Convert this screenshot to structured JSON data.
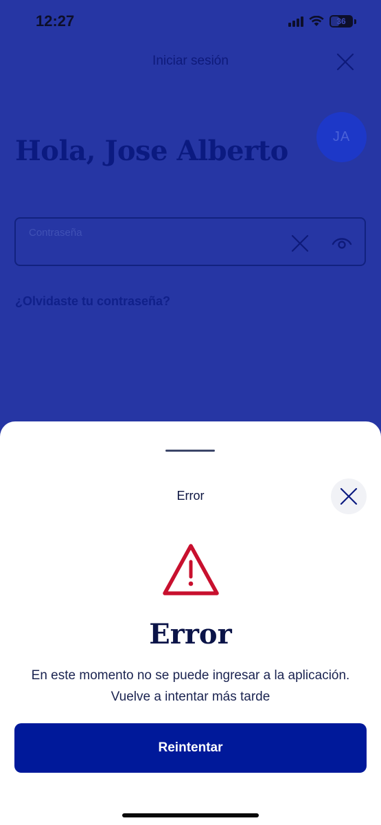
{
  "status_bar": {
    "time": "12:27",
    "battery": "36"
  },
  "login": {
    "header_title": "Iniciar sesión",
    "avatar_initials": "JA",
    "greeting": "Hola, Jose Alberto",
    "password_placeholder": "Contraseña",
    "forgot_password": "¿Olvidaste tu contraseña?"
  },
  "sheet": {
    "title": "Error",
    "heading": "Error",
    "message_line1": "En este momento no se puede ingresar a la aplicación.",
    "message_line2": "Vuelve a intentar más tarde",
    "retry_label": "Reintentar"
  },
  "icons": {
    "close": "close-icon",
    "clear": "clear-icon",
    "eye": "eye-icon",
    "warning": "warning-icon",
    "wifi": "wifi-icon",
    "signal": "signal-icon",
    "battery": "battery-icon"
  },
  "colors": {
    "overlay": "#2636a4",
    "primary_button": "#00199a",
    "warning_red": "#c8102e",
    "heading_text": "#0b1448"
  }
}
